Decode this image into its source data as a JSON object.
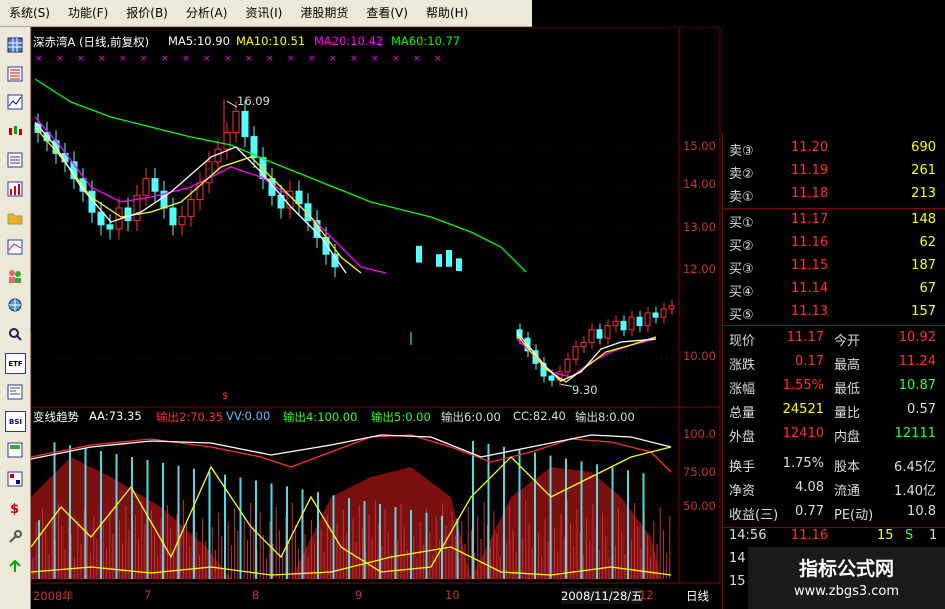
{
  "menubar": {
    "items": [
      "系统(S)",
      "功能(F)",
      "报价(B)",
      "分析(A)",
      "资讯(I)",
      "港股期货",
      "查看(V)",
      "帮助(H)"
    ]
  },
  "toolbar": {
    "icons": [
      "grid-icon",
      "table-icon",
      "line-chart-icon",
      "candle-icon",
      "list-icon",
      "bars-icon",
      "folder-icon",
      "compare-icon",
      "people-icon",
      "globe-icon",
      "search-icon",
      "etf-label",
      "news-icon",
      "bsi-label",
      "orders-icon",
      "block-icon",
      "money-icon",
      "tools-icon",
      "export-icon"
    ],
    "etf_label": "ETF",
    "bsi_label": "BSI"
  },
  "main_chart": {
    "title": "深赤湾A (日线,前复权)",
    "ma5": "MA5:10.90",
    "ma10": "MA10:10.51",
    "ma20": "MA20:10.42",
    "ma60": "MA60:10.77",
    "ma5_color": "#ffffff",
    "ma10_color": "#ffff00",
    "ma20_color": "#ff00ff",
    "ma60_color": "#00ff00",
    "high_marker": "16.09",
    "low_marker": "9.30",
    "price_ticks": [
      "15.00",
      "14.00",
      "13.00",
      "12.00",
      "10.00"
    ]
  },
  "indicator": {
    "name": "变线趋势",
    "aa": "AA:73.35",
    "out2": "输出2:70.35",
    "vv": "VV:0.00",
    "out4": "输出4:100.00",
    "out5": "输出5:0.00",
    "out6": "输出6:0.00",
    "cc": "CC:82.40",
    "out8": "输出8:0.00",
    "ticks": [
      "100.0",
      "75.00",
      "50.00"
    ]
  },
  "time_axis": {
    "labels": [
      "2008年",
      "7",
      "8",
      "9",
      "10",
      "2008/11/28/五",
      "12"
    ],
    "period": "日线"
  },
  "quote": {
    "sell": [
      {
        "label": "卖③",
        "price": "11.20",
        "vol": "690"
      },
      {
        "label": "卖②",
        "price": "11.19",
        "vol": "261"
      },
      {
        "label": "卖①",
        "price": "11.18",
        "vol": "213"
      }
    ],
    "buy": [
      {
        "label": "买①",
        "price": "11.17",
        "vol": "148"
      },
      {
        "label": "买②",
        "price": "11.16",
        "vol": "62"
      },
      {
        "label": "买③",
        "price": "11.15",
        "vol": "187"
      },
      {
        "label": "买④",
        "price": "11.14",
        "vol": "67"
      },
      {
        "label": "买⑤",
        "price": "11.13",
        "vol": "157"
      }
    ],
    "stats": [
      {
        "l1": "现价",
        "v1": "11.17",
        "l2": "今开",
        "v2": "10.92"
      },
      {
        "l1": "涨跌",
        "v1": "0.17",
        "l2": "最高",
        "v2": "11.24"
      },
      {
        "l1": "涨幅",
        "v1": "1.55%",
        "l2": "最低",
        "v2": "10.87"
      },
      {
        "l1": "总量",
        "v1": "24521",
        "l2": "量比",
        "v2": "0.57"
      },
      {
        "l1": "外盘",
        "v1": "12410",
        "l2": "内盘",
        "v2": "12111"
      },
      {
        "l1": "换手",
        "v1": "1.75%",
        "l2": "股本",
        "v2": "6.45亿"
      },
      {
        "l1": "净资",
        "v1": "4.08",
        "l2": "流通",
        "v2": "1.40亿"
      },
      {
        "l1": "收益(三)",
        "v1": "0.77",
        "l2": "PE(动)",
        "v2": "10.8"
      }
    ],
    "tick": {
      "time": "14:56",
      "price": "11.16",
      "vol": "15",
      "flag": "S",
      "count": "1"
    },
    "tick_partial": [
      "14",
      "15"
    ]
  },
  "watermark": {
    "title": "指标公式网",
    "url": "www.zbgs3.com"
  }
}
